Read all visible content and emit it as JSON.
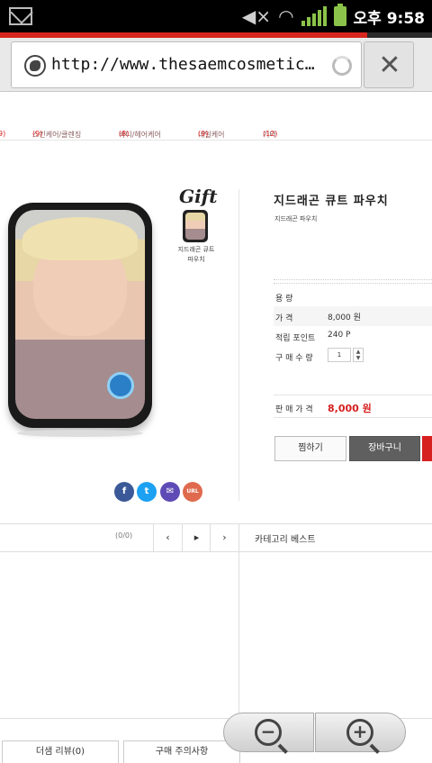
{
  "status_bar": {
    "time": "오후 9:58",
    "icons": [
      "mail-icon",
      "mute-icon",
      "wifi-icon",
      "signal-icon",
      "battery-icon"
    ]
  },
  "browser": {
    "url": "http://www.thesaemcosmetic…",
    "load_progress": 0.85,
    "close_icon": "✕",
    "accent_color": "#d7261d"
  },
  "category_nav": {
    "items": [
      {
        "label": "",
        "count": "9)"
      },
      {
        "label": "스킨케어/클렌징",
        "count": "(9)"
      },
      {
        "label": "바디/헤어케어",
        "count": "(8)"
      },
      {
        "label": "네일케어",
        "count": "(9)"
      },
      {
        "label": "기타",
        "count": "(12)"
      }
    ]
  },
  "product": {
    "gift_title": "Gift",
    "gift_item": "지드래곤 큐트 파우치",
    "name": "지드래곤 큐트 파우치",
    "subtitle": "지드래곤 파우치",
    "rows": [
      {
        "label": "용    량",
        "value": ""
      },
      {
        "label": "가    격",
        "value": "8,000 원"
      },
      {
        "label": "적립 포인트",
        "value": "240 P"
      },
      {
        "label": "구 매 수 량",
        "value": ""
      }
    ],
    "quantity": "1",
    "qty_up": "▲",
    "qty_down": "▼",
    "sale_label": "판 매 가 격",
    "sale_price": "8,000 원",
    "wish_button": "찜하기",
    "cart_button": "장바구니",
    "price_color": "#d61f1f"
  },
  "share": {
    "facebook": "f",
    "twitter": "t",
    "message": "✉",
    "url": "URL"
  },
  "section": {
    "page_count": "(0/0)",
    "first": "‹",
    "prev": "‹",
    "next": "▸",
    "last": "›",
    "category_best": "카테고리 베스트"
  },
  "tabs": {
    "review": "더샘 리뷰(0)",
    "notice": "구매 주의사항"
  },
  "zoom": {
    "out": "−",
    "in": "+"
  }
}
